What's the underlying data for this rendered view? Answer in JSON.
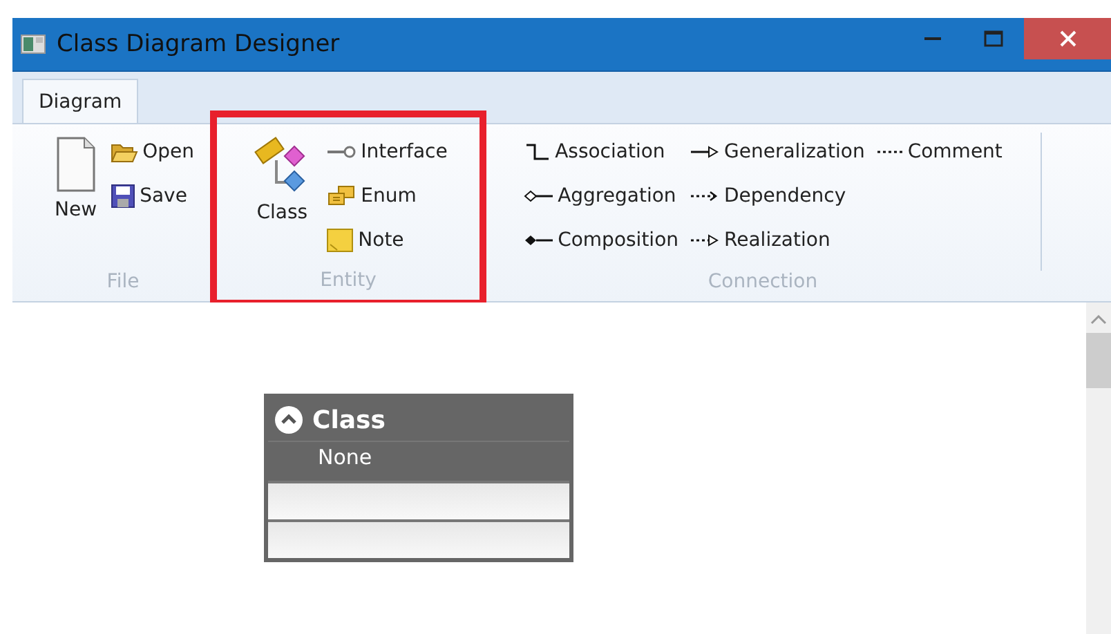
{
  "window": {
    "title": "Class Diagram Designer"
  },
  "tabs": [
    {
      "label": "Diagram",
      "selected": true
    }
  ],
  "groups": [
    {
      "label": "File",
      "highlighted": false,
      "large": [
        {
          "label": "New",
          "kind": "new"
        }
      ],
      "columns": [
        [
          {
            "label": "Open",
            "kind": "open"
          },
          {
            "label": "Save",
            "kind": "save"
          }
        ]
      ]
    },
    {
      "label": "Entity",
      "highlighted": true,
      "large": [
        {
          "label": "Class",
          "kind": "class"
        }
      ],
      "columns": [
        [
          {
            "label": "Interface",
            "kind": "interface"
          },
          {
            "label": "Enum",
            "kind": "enum"
          },
          {
            "label": "Note",
            "kind": "note"
          }
        ]
      ]
    },
    {
      "label": "Connection",
      "highlighted": false,
      "columns": [
        [
          {
            "label": "Association",
            "kind": "association"
          },
          {
            "label": "Aggregation",
            "kind": "aggregation"
          },
          {
            "label": "Composition",
            "kind": "composition"
          }
        ],
        [
          {
            "label": "Generalization",
            "kind": "generalization"
          },
          {
            "label": "Dependency",
            "kind": "dependency"
          },
          {
            "label": "Realization",
            "kind": "realization"
          }
        ],
        [
          {
            "label": "Comment",
            "kind": "comment"
          }
        ]
      ]
    }
  ],
  "canvas": {
    "node": {
      "name": "Class",
      "modifier": "None",
      "expanded": true
    }
  }
}
